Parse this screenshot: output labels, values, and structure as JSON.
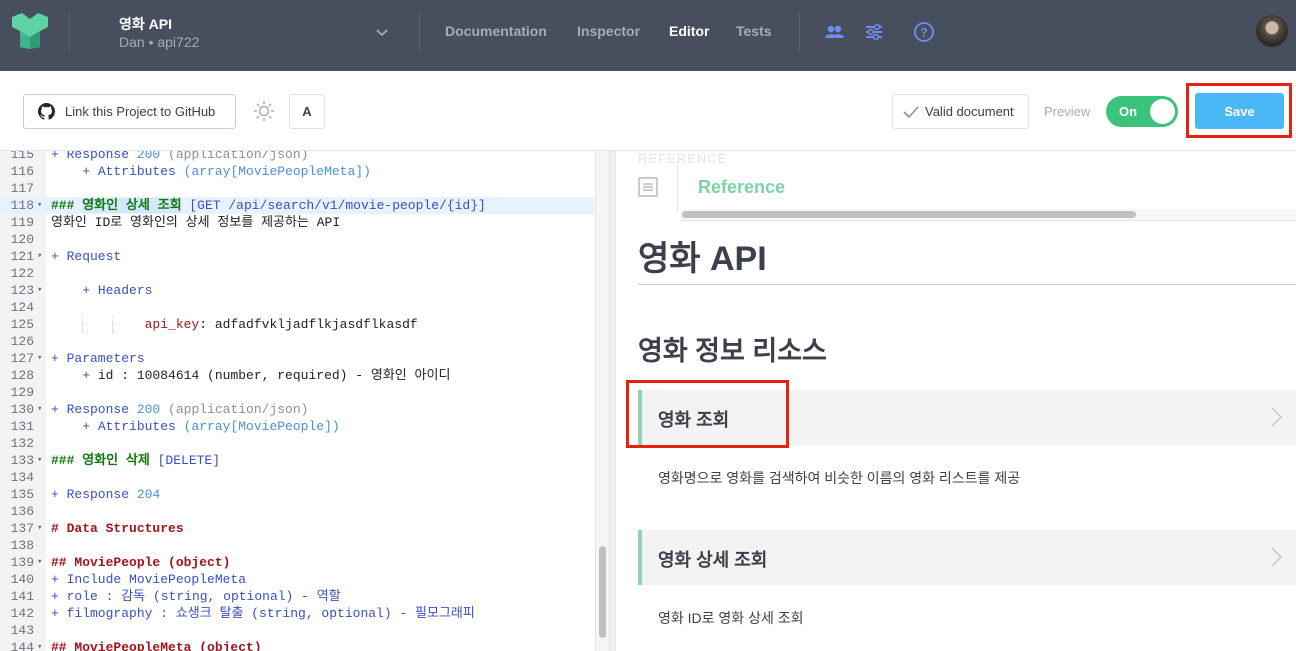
{
  "header": {
    "project_title": "영화 API",
    "project_sub": "Dan • api722",
    "nav": [
      "Documentation",
      "Inspector",
      "Editor",
      "Tests"
    ],
    "active_nav": "Editor"
  },
  "toolbar": {
    "github_label": "Link this Project to GitHub",
    "font_label": "A",
    "valid_label": "Valid document",
    "preview_label": "Preview",
    "toggle_label": "On",
    "save_label": "Save"
  },
  "editor": {
    "lines": [
      {
        "n": "115",
        "fold": "",
        "tokens": [
          [
            "t-plus",
            "+ Response "
          ],
          [
            "t-num",
            "200"
          ],
          [
            "t-dim",
            " (application/json)"
          ]
        ]
      },
      {
        "n": "116",
        "fold": "",
        "tokens": [
          [
            "t-txt",
            "    "
          ],
          [
            "t-plus",
            "+ Attributes "
          ],
          [
            "t-arr",
            "(array[MoviePeopleMeta])"
          ]
        ]
      },
      {
        "n": "117",
        "fold": "",
        "tokens": []
      },
      {
        "n": "118",
        "fold": "▾",
        "hl": true,
        "tokens": [
          [
            "t-h",
            "### "
          ],
          [
            "t-h t-sel",
            "영화인 상세 조회"
          ],
          [
            "t-txt",
            " "
          ],
          [
            "t-get",
            "[GET /api/search/v1/movie-people/{id}]"
          ]
        ]
      },
      {
        "n": "119",
        "fold": "",
        "tokens": [
          [
            "t-txt",
            "영화인 ID로 영화인의 상세 정보를 제공하는 API"
          ]
        ]
      },
      {
        "n": "120",
        "fold": "",
        "tokens": []
      },
      {
        "n": "121",
        "fold": "▾",
        "tokens": [
          [
            "t-plus",
            "+ Request"
          ]
        ]
      },
      {
        "n": "122",
        "fold": "",
        "tokens": []
      },
      {
        "n": "123",
        "fold": "▾",
        "tokens": [
          [
            "t-txt",
            "    "
          ],
          [
            "t-plus",
            "+ Headers"
          ]
        ]
      },
      {
        "n": "124",
        "fold": "",
        "tokens": []
      },
      {
        "n": "125",
        "fold": "",
        "tokens": [
          [
            "t-txt",
            "            "
          ],
          [
            "t-key",
            "api_key"
          ],
          [
            "t-txt",
            ": adfadfvkljadflkjasdflkasdf"
          ]
        ]
      },
      {
        "n": "126",
        "fold": "",
        "tokens": []
      },
      {
        "n": "127",
        "fold": "▾",
        "tokens": [
          [
            "t-plus",
            "+ Parameters"
          ]
        ]
      },
      {
        "n": "128",
        "fold": "",
        "tokens": [
          [
            "t-txt",
            "    "
          ],
          [
            "t-plus",
            "+ "
          ],
          [
            "t-txt",
            "id : 10084614 (number, required) - 영화인 아이디"
          ]
        ]
      },
      {
        "n": "129",
        "fold": "",
        "tokens": []
      },
      {
        "n": "130",
        "fold": "▾",
        "tokens": [
          [
            "t-plus",
            "+ Response "
          ],
          [
            "t-num",
            "200"
          ],
          [
            "t-dim",
            " (application/json)"
          ]
        ]
      },
      {
        "n": "131",
        "fold": "",
        "tokens": [
          [
            "t-txt",
            "    "
          ],
          [
            "t-plus",
            "+ Attributes "
          ],
          [
            "t-arr",
            "(array[MoviePeople])"
          ]
        ]
      },
      {
        "n": "132",
        "fold": "",
        "tokens": []
      },
      {
        "n": "133",
        "fold": "▾",
        "tokens": [
          [
            "t-h",
            "### 영화인 삭제 "
          ],
          [
            "t-get",
            "[DELETE]"
          ]
        ]
      },
      {
        "n": "134",
        "fold": "",
        "tokens": []
      },
      {
        "n": "135",
        "fold": "",
        "tokens": [
          [
            "t-plus",
            "+ Response "
          ],
          [
            "t-num",
            "204"
          ]
        ]
      },
      {
        "n": "136",
        "fold": "",
        "tokens": []
      },
      {
        "n": "137",
        "fold": "▾",
        "tokens": [
          [
            "t-h2",
            "# Data Structures"
          ]
        ]
      },
      {
        "n": "138",
        "fold": "",
        "tokens": []
      },
      {
        "n": "139",
        "fold": "▾",
        "tokens": [
          [
            "t-h2",
            "## MoviePeople (object)"
          ]
        ]
      },
      {
        "n": "140",
        "fold": "",
        "tokens": [
          [
            "t-plus",
            "+ Include MoviePeopleMeta"
          ]
        ]
      },
      {
        "n": "141",
        "fold": "",
        "tokens": [
          [
            "t-plus",
            "+ role : 감독 (string, optional) - 역할"
          ]
        ]
      },
      {
        "n": "142",
        "fold": "",
        "tokens": [
          [
            "t-plus",
            "+ filmography : 쇼생크 탈출 (string, optional) - 필모그래피"
          ]
        ]
      },
      {
        "n": "143",
        "fold": "",
        "tokens": []
      },
      {
        "n": "144",
        "fold": "▾",
        "tokens": [
          [
            "t-h2",
            "## MoviePeopleMeta (object)"
          ]
        ]
      }
    ]
  },
  "preview": {
    "ghost_label": "REFERENCE",
    "reference_title": "Reference",
    "api_title": "영화 API",
    "group_title": "영화 정보 리소스",
    "resources": [
      {
        "name": "영화 조회",
        "description": "영화명으로 영화를 검색하여 비슷한 이름의 영화 리스트를 제공"
      },
      {
        "name": "영화 상세 조회",
        "description": "영화 ID로 영화 상세 조회"
      }
    ]
  },
  "colors": {
    "topbar": "#474e5d",
    "save": "#49b8f5",
    "toggle_on": "#3cc37b",
    "accent_green": "#7cd3a6",
    "highlight_box": "#e4220f"
  }
}
